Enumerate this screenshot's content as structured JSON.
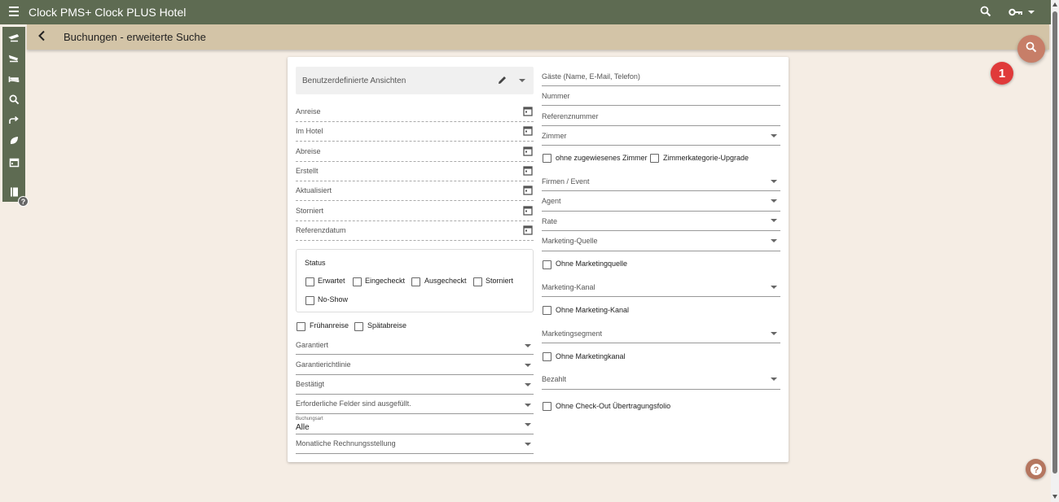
{
  "app": {
    "title": "Clock PMS+   Clock PLUS Hotel"
  },
  "subbar": {
    "title": "Buchungen - erweiterte Suche"
  },
  "badge": {
    "number": "1"
  },
  "sidebar": {
    "items": [
      {
        "icon": "departure-plane-icon"
      },
      {
        "icon": "arrival-plane-icon"
      },
      {
        "icon": "bed-icon"
      },
      {
        "icon": "search-icon"
      },
      {
        "icon": "redo-arrow-icon"
      },
      {
        "icon": "leaf-icon"
      },
      {
        "icon": "calendar-icon"
      },
      {
        "icon": "book-icon"
      }
    ],
    "help": "?"
  },
  "form": {
    "views_label": "Benutzerdefinierte Ansichten",
    "left_dates": [
      "Anreise",
      "Im Hotel",
      "Abreise",
      "Erstellt",
      "Aktualisiert",
      "Storniert",
      "Referenzdatum"
    ],
    "status": {
      "title": "Status",
      "options": [
        "Erwartet",
        "Eingecheckt",
        "Ausgecheckt",
        "Storniert",
        "No-Show"
      ]
    },
    "early_late": [
      "Frühanreise",
      "Spätabreise"
    ],
    "left_selects": [
      "Garantiert",
      "Garantierichtlinie",
      "Bestätigt",
      "Erforderliche Felder sind ausgefüllt."
    ],
    "booking_type": {
      "label": "Buchungsart",
      "value": "Alle"
    },
    "monthly_billing": "Monatliche Rechnungsstellung",
    "right": {
      "guests": "Gäste (Name, E-Mail, Telefon)",
      "number": "Nummer",
      "reference": "Referenznummer",
      "room": "Zimmer",
      "no_room": "ohne zugewiesenes Zimmer",
      "upgrade": "Zimmerkategorie-Upgrade",
      "companies": "Firmen / Event",
      "agent": "Agent",
      "rate": "Rate",
      "marketing_source": "Marketing-Quelle",
      "no_marketing_source": "Ohne Marketingquelle",
      "marketing_channel": "Marketing-Kanal",
      "no_marketing_channel": "Ohne Marketing-Kanal",
      "marketing_segment": "Marketingsegment",
      "no_marketing_channel2": "Ohne Marketingkanal",
      "paid": "Bezahlt",
      "no_checkout": "Ohne Check-Out Übertragungsfolio"
    }
  },
  "help_button": "?"
}
